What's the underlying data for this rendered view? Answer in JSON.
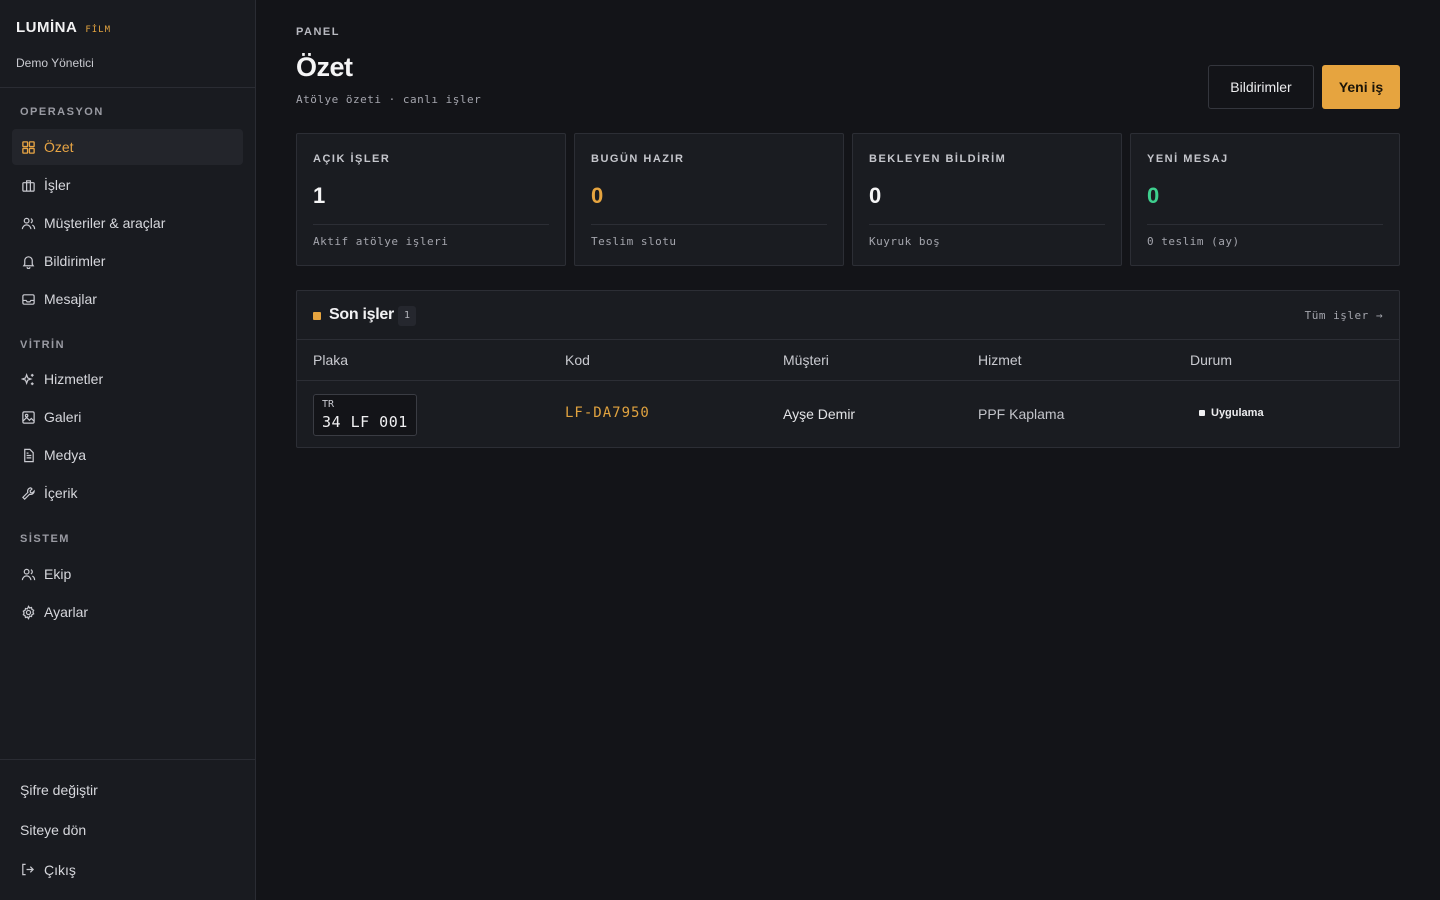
{
  "brand": {
    "name": "LUMİNA",
    "tag": "FİLM"
  },
  "user": {
    "name": "Demo Yönetici"
  },
  "sidebar": {
    "sections": [
      {
        "label": "OPERASYON",
        "items": [
          {
            "label": "Özet",
            "icon": "dashboard-icon",
            "active": true
          },
          {
            "label": "İşler",
            "icon": "briefcase-icon"
          },
          {
            "label": "Müşteriler & araçlar",
            "icon": "users-icon"
          },
          {
            "label": "Bildirimler",
            "icon": "bell-icon"
          },
          {
            "label": "Mesajlar",
            "icon": "inbox-icon"
          }
        ]
      },
      {
        "label": "VİTRİN",
        "items": [
          {
            "label": "Hizmetler",
            "icon": "sparkle-icon"
          },
          {
            "label": "Galeri",
            "icon": "image-icon"
          },
          {
            "label": "Medya",
            "icon": "file-icon"
          },
          {
            "label": "İçerik",
            "icon": "wrench-icon"
          }
        ]
      },
      {
        "label": "SİSTEM",
        "items": [
          {
            "label": "Ekip",
            "icon": "team-icon"
          },
          {
            "label": "Ayarlar",
            "icon": "gear-icon"
          }
        ]
      }
    ],
    "footer": {
      "change_password": "Şifre değiştir",
      "back_to_site": "Siteye dön",
      "logout": "Çıkış"
    }
  },
  "header": {
    "crumb": "PANEL",
    "title": "Özet",
    "subtitle": "Atölye özeti · canlı işler",
    "notifications_button": "Bildirimler",
    "new_job_button": "Yeni iş"
  },
  "stats": [
    {
      "label": "AÇIK İŞLER",
      "value": "1",
      "note": "Aktif atölye işleri",
      "color": "#f5f5f6"
    },
    {
      "label": "BUGÜN HAZIR",
      "value": "0",
      "note": "Teslim slotu",
      "color": "#e6a43f"
    },
    {
      "label": "BEKLEYEN BİLDİRİM",
      "value": "0",
      "note": "Kuyruk boş",
      "color": "#f5f5f6"
    },
    {
      "label": "YENİ MESAJ",
      "value": "0",
      "note": "0 teslim (ay)",
      "color": "#3ecf8e"
    }
  ],
  "recent_jobs": {
    "title": "Son işler",
    "count": "1",
    "all_link": "Tüm işler →",
    "columns": [
      "Plaka",
      "Kod",
      "Müşteri",
      "Hizmet",
      "Durum"
    ],
    "rows": [
      {
        "plate_country": "TR",
        "plate": "34 LF 001",
        "code": "LF-DA7950",
        "customer": "Ayşe Demir",
        "service": "PPF Kaplama",
        "status": "Uygulama"
      }
    ]
  },
  "colors": {
    "accent": "#e6a43f",
    "success": "#3ecf8e",
    "background": "#131418",
    "sidebar": "#191b20"
  }
}
